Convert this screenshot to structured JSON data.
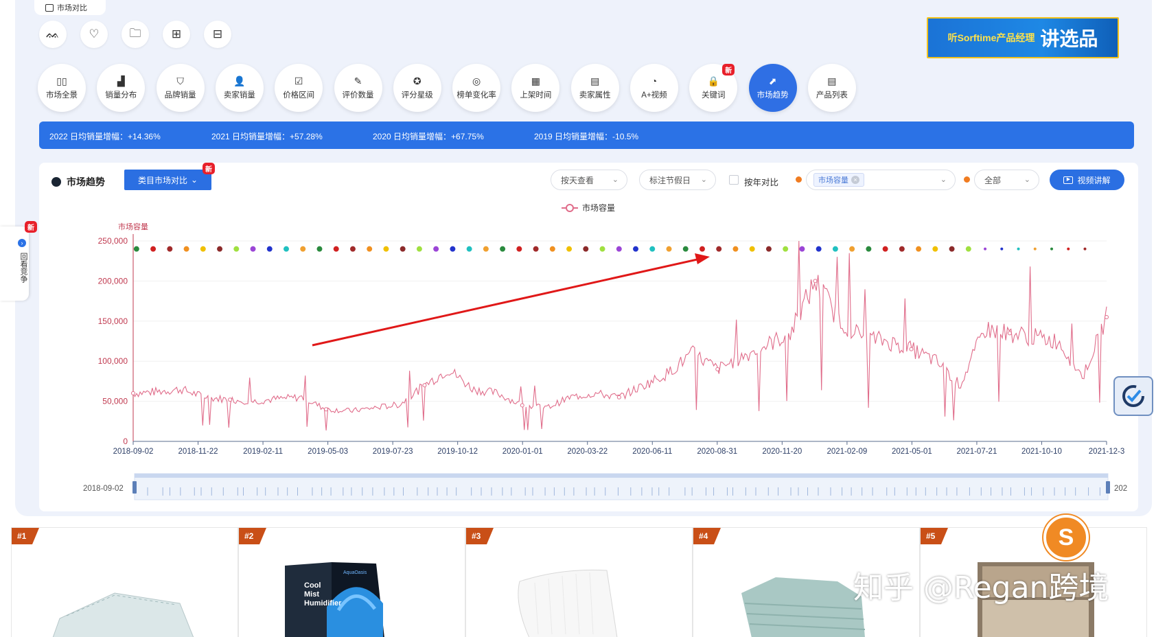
{
  "compare_tab": {
    "label": "市场对比"
  },
  "quick_icons": [
    {
      "name": "footprint-icon",
      "glyph": "ᨐ"
    },
    {
      "name": "heart-icon",
      "glyph": "♡"
    },
    {
      "name": "folder-icon",
      "glyph": "🗀"
    },
    {
      "name": "apps-icon",
      "glyph": "⊞"
    },
    {
      "name": "gift-icon",
      "glyph": "⊟"
    }
  ],
  "banner": {
    "small": "听Sorftime产品经理",
    "big": "讲选品"
  },
  "nav": [
    {
      "label": "市场全景",
      "icon": "layout-icon",
      "glyph": "▯▯"
    },
    {
      "label": "销量分布",
      "icon": "bar-chart-icon",
      "glyph": "▟"
    },
    {
      "label": "品牌销量",
      "icon": "brand-icon",
      "glyph": "⛉"
    },
    {
      "label": "卖家销量",
      "icon": "seller-icon",
      "glyph": "👤"
    },
    {
      "label": "价格区间",
      "icon": "price-icon",
      "glyph": "☑"
    },
    {
      "label": "评价数量",
      "icon": "review-icon",
      "glyph": "✎"
    },
    {
      "label": "评分星级",
      "icon": "star-icon",
      "glyph": "✪"
    },
    {
      "label": "榜单变化率",
      "icon": "rank-change-icon",
      "glyph": "◎"
    },
    {
      "label": "上架时间",
      "icon": "calendar-icon",
      "glyph": "▦"
    },
    {
      "label": "卖家属性",
      "icon": "seller-attr-icon",
      "glyph": "▤"
    },
    {
      "label": "A+视频",
      "icon": "video-pie-icon",
      "glyph": "◔"
    },
    {
      "label": "关键词",
      "icon": "lock-icon",
      "glyph": "🔒",
      "badge": "新"
    },
    {
      "label": "市场趋势",
      "icon": "trend-icon",
      "glyph": "⬈",
      "active": true
    },
    {
      "label": "产品列表",
      "icon": "list-icon",
      "glyph": "▤"
    }
  ],
  "stats": [
    {
      "label": "2022 日均销量增幅：",
      "value": "+14.36%"
    },
    {
      "label": "2021 日均销量增幅：",
      "value": "+57.28%"
    },
    {
      "label": "2020 日均销量增幅：",
      "value": "+67.75%"
    },
    {
      "label": "2019 日均销量增幅：",
      "value": "-10.5%"
    }
  ],
  "card": {
    "title": "市场趋势",
    "category_button": "类目市场对比",
    "category_badge": "新",
    "view_select": "按天查看",
    "holiday_select": "标注节假日",
    "yoy_label": "按年对比",
    "metric_tag": "市场容量",
    "scope_select": "全部",
    "video_button": "视频讲解",
    "legend": "市场容量",
    "y_axis_name": "市场容量"
  },
  "side_tab": {
    "badge": "新",
    "label": "回看竞争"
  },
  "slider": {
    "start_label": "2018-09-02",
    "end_label": "202"
  },
  "chart_data": {
    "type": "line",
    "series": [
      {
        "name": "市场容量",
        "x": [
          "2018-09-02",
          "2018-10-01",
          "2018-11-01",
          "2018-12-01",
          "2019-01-01",
          "2019-02-01",
          "2019-03-01",
          "2019-04-01",
          "2019-05-01",
          "2019-06-01",
          "2019-07-01",
          "2019-08-01",
          "2019-09-01",
          "2019-10-01",
          "2019-11-01",
          "2019-12-01",
          "2020-01-01",
          "2020-02-01",
          "2020-03-01",
          "2020-04-01",
          "2020-05-01",
          "2020-06-01",
          "2020-07-01",
          "2020-08-01",
          "2020-09-01",
          "2020-10-01",
          "2020-11-01",
          "2020-12-01",
          "2021-01-01",
          "2021-02-01",
          "2021-03-01",
          "2021-04-01",
          "2021-05-01",
          "2021-06-01",
          "2021-07-01",
          "2021-08-01",
          "2021-09-01",
          "2021-10-01",
          "2021-11-01",
          "2021-12-01",
          "2021-12-31"
        ],
        "values": [
          60000,
          62000,
          65000,
          55000,
          52000,
          50000,
          53000,
          55000,
          40000,
          38000,
          42000,
          46000,
          70000,
          90000,
          65000,
          60000,
          45000,
          42000,
          55000,
          60000,
          55000,
          70000,
          85000,
          110000,
          90000,
          105000,
          120000,
          135000,
          200000,
          150000,
          130000,
          125000,
          115000,
          100000,
          70000,
          140000,
          135000,
          130000,
          125000,
          80000,
          155000
        ]
      }
    ],
    "holidays_y": 240000,
    "xlabel": "",
    "ylabel": "市场容量",
    "y_ticks": [
      0,
      50000,
      100000,
      150000,
      200000,
      250000
    ],
    "y_tick_labels": [
      "0",
      "50,000",
      "100,000",
      "150,000",
      "200,000",
      "250,000"
    ],
    "ylim": [
      0,
      250000
    ],
    "x_tick_labels": [
      "2018-09-02",
      "2018-11-22",
      "2019-02-11",
      "2019-05-03",
      "2019-07-23",
      "2019-10-12",
      "2020-01-01",
      "2020-03-22",
      "2020-06-11",
      "2020-08-31",
      "2020-11-20",
      "2021-02-09",
      "2021-05-01",
      "2021-07-21",
      "2021-10-10",
      "2021-12-3"
    ],
    "grid": true,
    "legend": "top-center",
    "colors": {
      "line": "#e06c8a",
      "axis_text": "#c0394f",
      "tick_text": "#2c3e66"
    }
  },
  "products": [
    {
      "rank": "#1",
      "item": "bed-sheet-image"
    },
    {
      "rank": "#2",
      "item": "humidifier-box-image",
      "box_text": "Cool Mist Humidifier",
      "brand": "AquaOasis"
    },
    {
      "rank": "#3",
      "item": "pillow-image"
    },
    {
      "rank": "#4",
      "item": "folded-sheets-image"
    },
    {
      "rank": "#5",
      "item": "bed-headboard-image"
    }
  ],
  "footer_watermark": "知乎 @Regan跨境"
}
